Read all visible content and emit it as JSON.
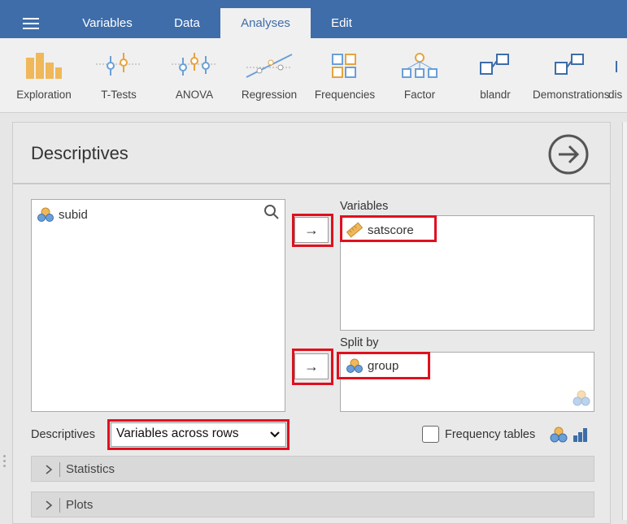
{
  "menu": {
    "tabs": [
      {
        "label": "Variables"
      },
      {
        "label": "Data"
      },
      {
        "label": "Analyses",
        "active": true
      },
      {
        "label": "Edit"
      }
    ]
  },
  "ribbon": {
    "items": [
      {
        "label": "Exploration",
        "icon": "exploration-icon"
      },
      {
        "label": "T-Tests",
        "icon": "ttests-icon"
      },
      {
        "label": "ANOVA",
        "icon": "anova-icon"
      },
      {
        "label": "Regression",
        "icon": "regression-icon"
      },
      {
        "label": "Frequencies",
        "icon": "frequencies-icon"
      },
      {
        "label": "Factor",
        "icon": "factor-icon"
      },
      {
        "label": "blandr",
        "icon": "module-icon"
      },
      {
        "label": "Demonstrations",
        "icon": "module-icon"
      },
      {
        "label": "dis",
        "icon": "module-icon"
      }
    ]
  },
  "panel": {
    "title": "Descriptives",
    "source_vars": [
      {
        "name": "subid",
        "icon": "nominal-icon"
      }
    ],
    "variables_label": "Variables",
    "variables": [
      {
        "name": "satscore",
        "icon": "continuous-icon"
      }
    ],
    "splitby_label": "Split by",
    "splitby": [
      {
        "name": "group",
        "icon": "nominal-icon"
      }
    ],
    "arrow": "→",
    "descriptives_label": "Descriptives",
    "descriptives_select": "Variables across rows",
    "frequency_tables_label": "Frequency tables",
    "frequency_tables_checked": false,
    "sections": [
      {
        "label": "Statistics"
      },
      {
        "label": "Plots"
      }
    ]
  },
  "colors": {
    "accent": "#3e6da9",
    "highlight": "#e0101e"
  }
}
